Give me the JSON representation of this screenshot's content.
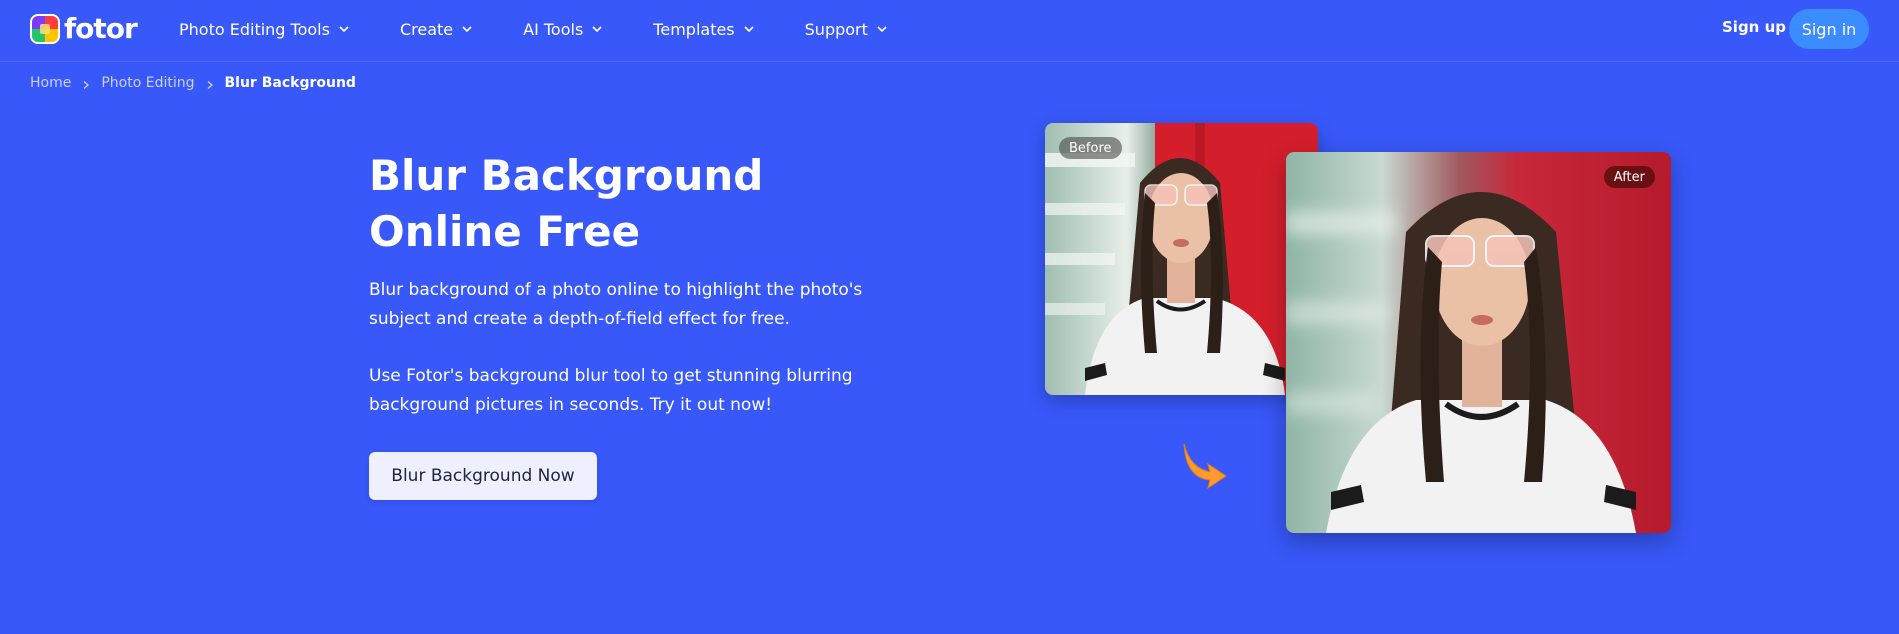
{
  "brand": {
    "name": "fotor"
  },
  "nav": {
    "items": [
      {
        "label": "Photo Editing Tools"
      },
      {
        "label": "Create"
      },
      {
        "label": "AI Tools"
      },
      {
        "label": "Templates"
      },
      {
        "label": "Support"
      }
    ]
  },
  "auth": {
    "signup_label": "Sign up",
    "signin_label": "Sign in"
  },
  "breadcrumb": {
    "items": [
      {
        "label": "Home"
      },
      {
        "label": "Photo Editing"
      },
      {
        "label": "Blur Background"
      }
    ]
  },
  "hero": {
    "title": "Blur Background Online Free",
    "paragraph1": "Blur background of a photo online to highlight the photo's subject and create a depth-of-field effect for free.",
    "paragraph2": "Use Fotor's background blur tool to get stunning blurring background pictures in seconds. Try it out now!",
    "cta_label": "Blur Background Now"
  },
  "comparison": {
    "before_label": "Before",
    "after_label": "After"
  },
  "colors": {
    "background": "#3858f9",
    "signin_button": "#3b8cff",
    "cta_background": "#eef0ff",
    "arrow": "#ff9a2e",
    "after_tag": "#6a0f12"
  },
  "icons": {
    "nav_chevron": "chevron-down-icon",
    "breadcrumb_separator": "chevron-right-icon",
    "transition_arrow": "curved-arrow-icon"
  }
}
